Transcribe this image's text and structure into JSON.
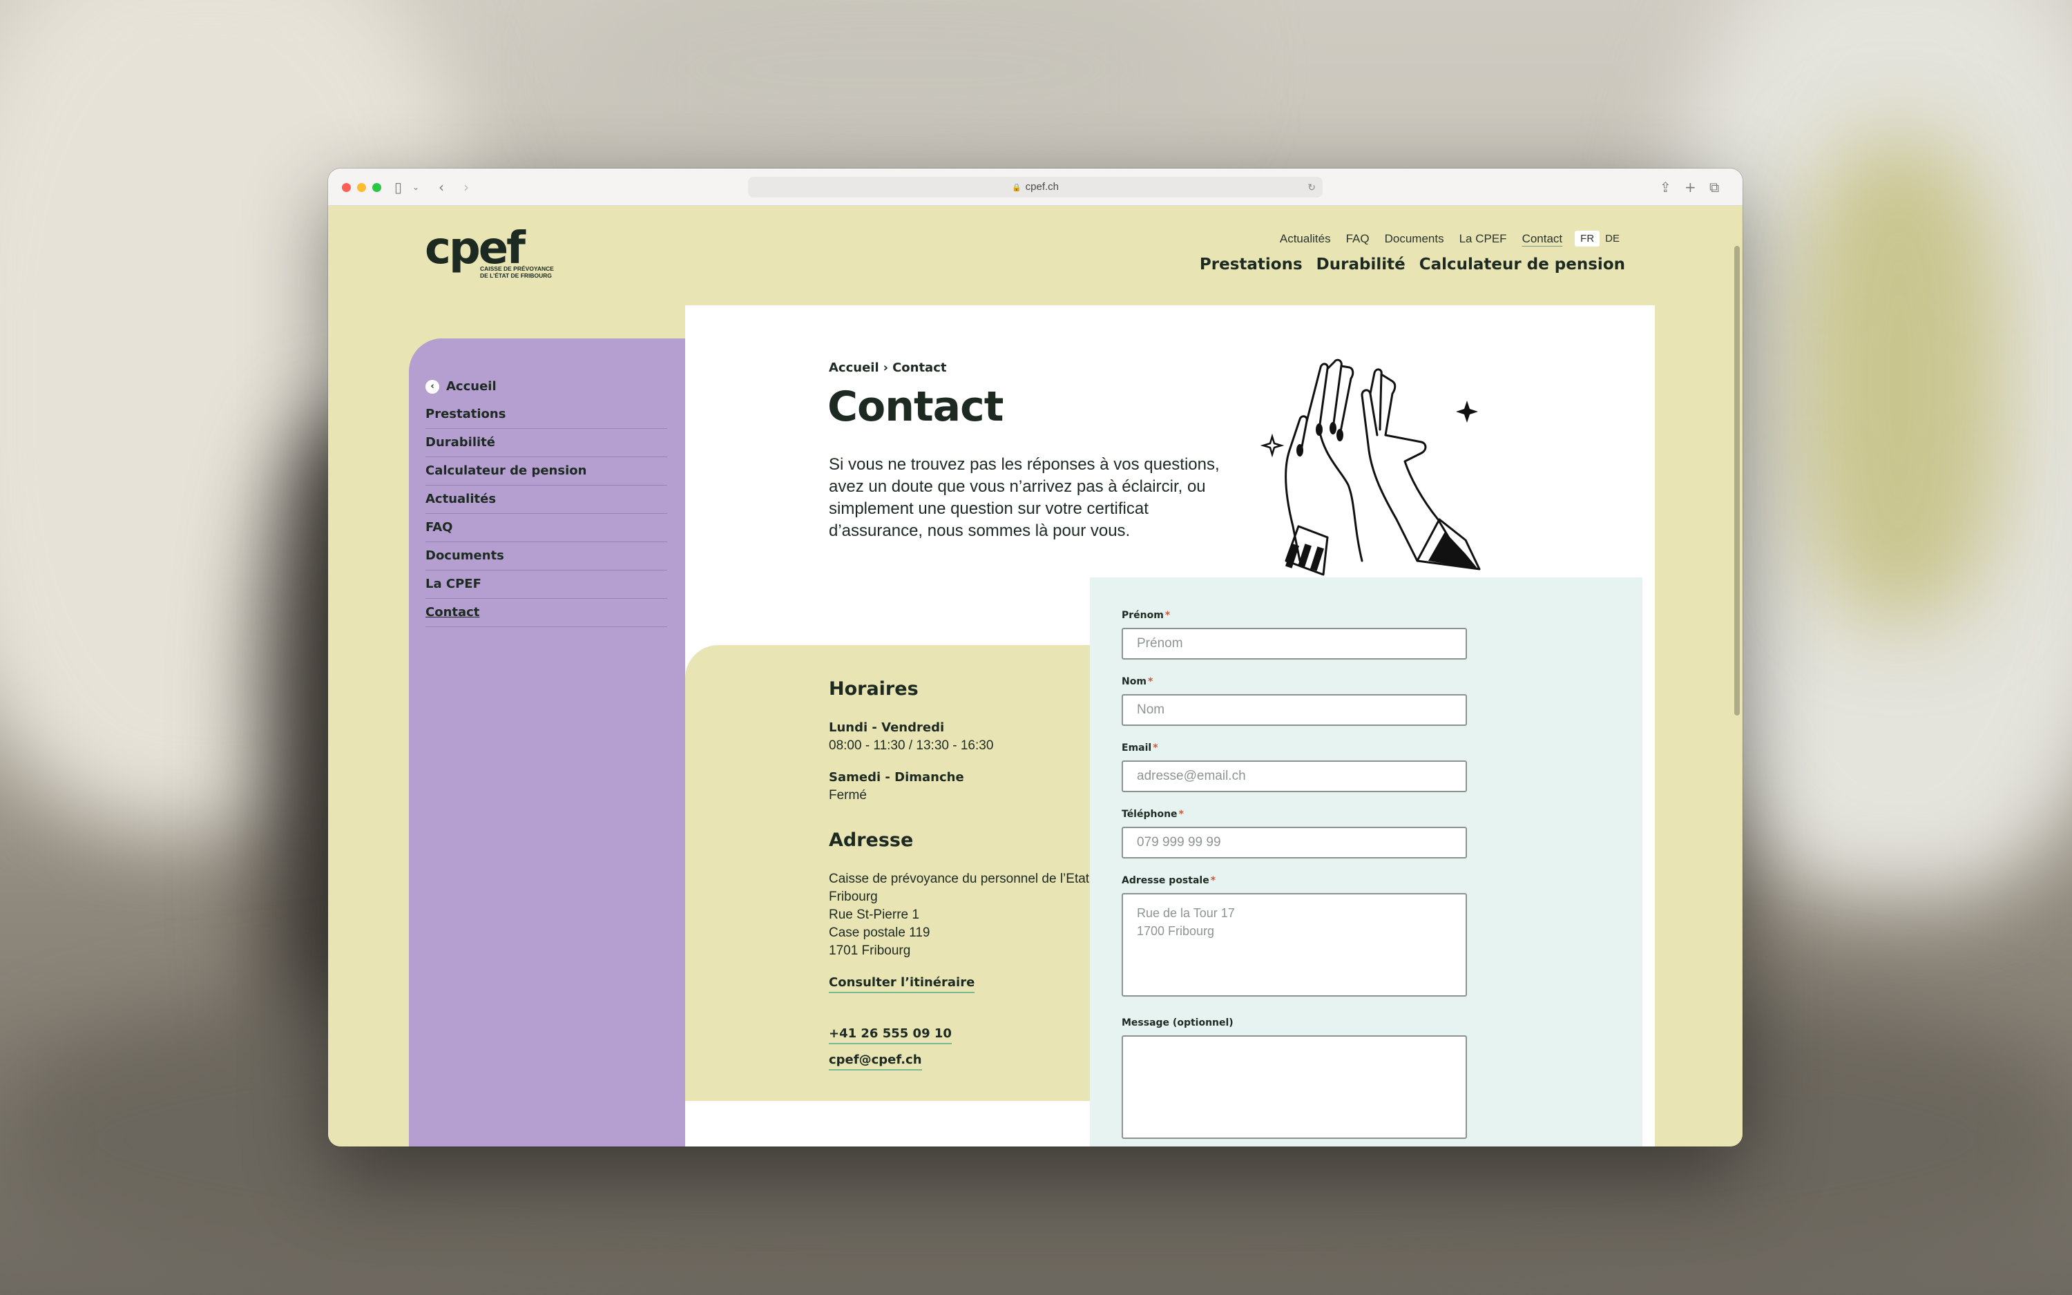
{
  "browser": {
    "url": "cpef.ch"
  },
  "logo": {
    "word": "cpef",
    "sub_line1": "CAISSE DE PRÉVOYANCE",
    "sub_line2": "DE L’ÉTAT DE FRIBOURG"
  },
  "topnav": {
    "items": [
      "Actualités",
      "FAQ",
      "Documents",
      "La CPEF",
      "Contact"
    ],
    "lang": [
      "FR",
      "DE"
    ]
  },
  "mainnav": {
    "items": [
      "Prestations",
      "Durabilité",
      "Calculateur de pension"
    ]
  },
  "sidebar": {
    "back": "Accueil",
    "items": [
      "Prestations",
      "Durabilité",
      "Calculateur de pension",
      "Actualités",
      "FAQ",
      "Documents",
      "La CPEF",
      "Contact"
    ]
  },
  "breadcrumb": {
    "home": "Accueil",
    "sep": "›",
    "current": "Contact"
  },
  "page": {
    "title": "Contact",
    "intro": "Si vous ne trouvez pas les réponses à vos questions, avez un doute que vous n’arrivez pas à éclaircir, ou simplement une question sur votre certificat d’assurance, nous sommes là pour vous."
  },
  "hours": {
    "heading": "Horaires",
    "weekday_label": "Lundi - Vendredi",
    "weekday_value": "08:00 - 11:30 / 13:30 - 16:30",
    "weekend_label": "Samedi - Dimanche",
    "weekend_value": "Fermé"
  },
  "address": {
    "heading": "Adresse",
    "line1": "Caisse de prévoyance du personnel de l’Etat de Fribourg",
    "line2": "Rue St-Pierre 1",
    "line3": "Case postale 119",
    "line4": "1701 Fribourg",
    "route_link": "Consulter l’itinéraire",
    "phone": "+41 26 555 09 10",
    "email": "cpef@cpef.ch"
  },
  "form": {
    "firstname_label": "Prénom",
    "firstname_placeholder": "Prénom",
    "lastname_label": "Nom",
    "lastname_placeholder": "Nom",
    "email_label": "Email",
    "email_placeholder": "adresse@email.ch",
    "phone_label": "Téléphone",
    "phone_placeholder": "079 999 99 99",
    "postal_label": "Adresse postale",
    "postal_placeholder": "Rue de la Tour 17\n1700 Fribourg",
    "message_label": "Message (optionnel)",
    "required_mark": "*"
  }
}
